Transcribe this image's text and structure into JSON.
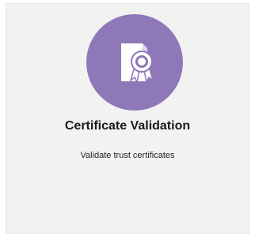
{
  "tile": {
    "title": "Certificate Validation",
    "description": "Validate trust certificates",
    "icon": "certificate-icon",
    "icon_bg_color": "#8e78b8",
    "tile_bg_color": "#f2f2f2"
  }
}
